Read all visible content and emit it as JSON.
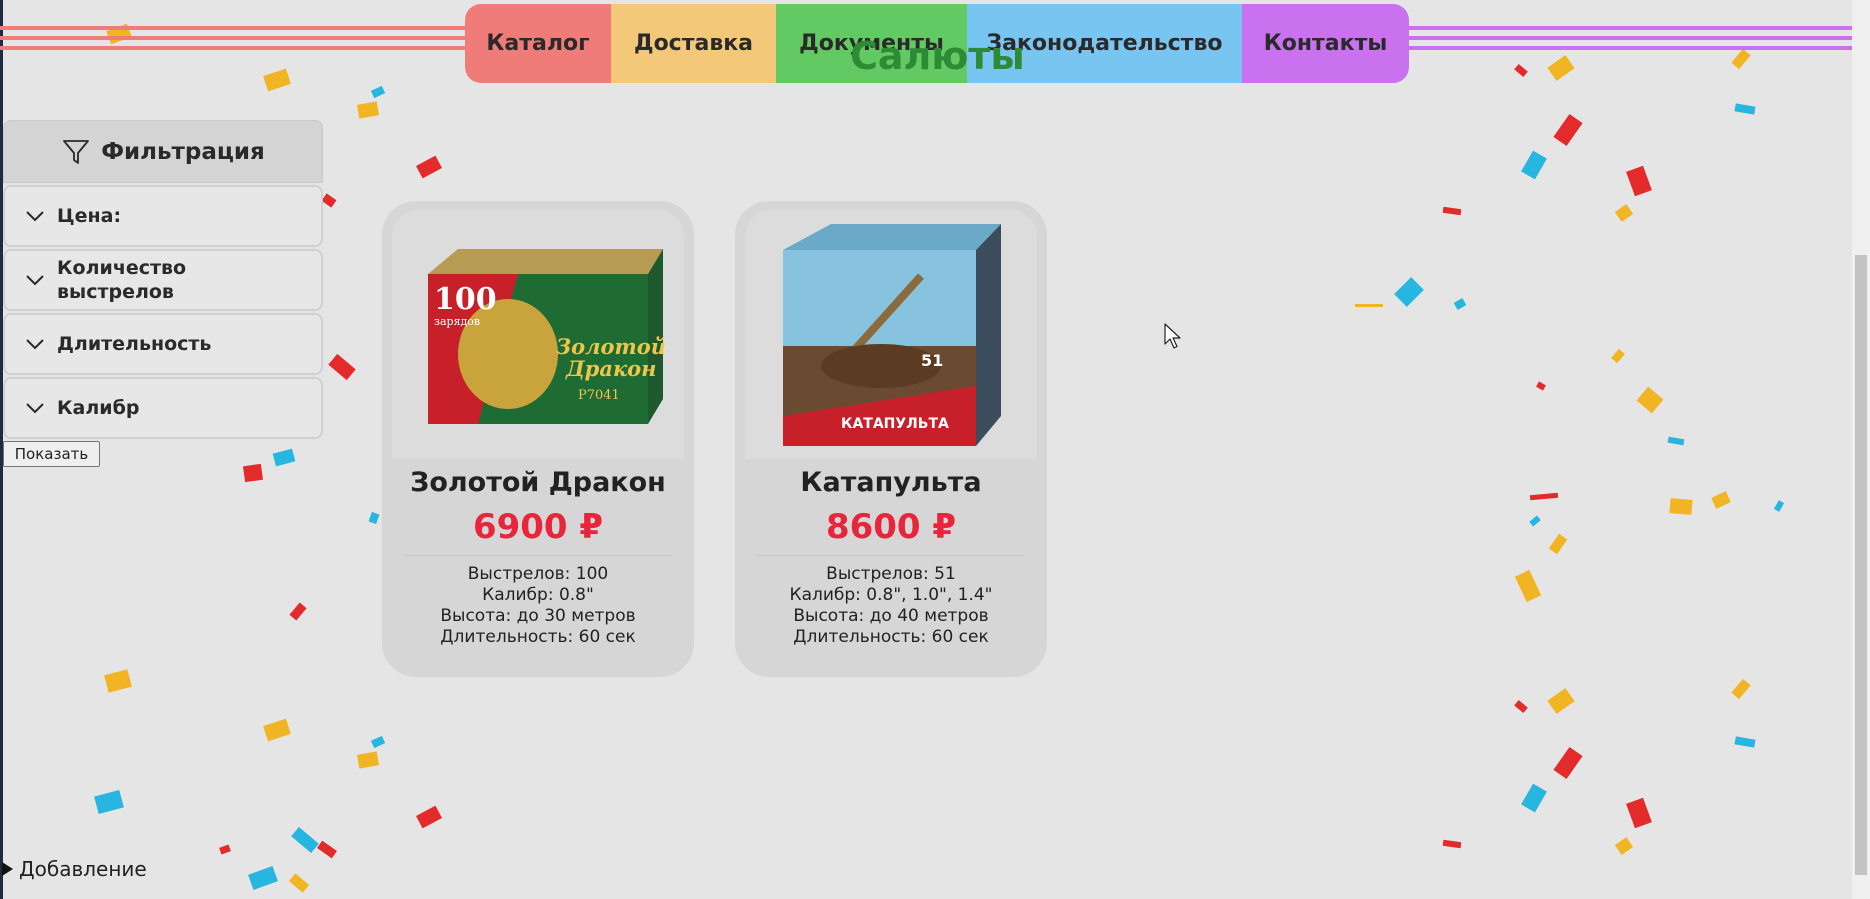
{
  "nav": {
    "items": [
      {
        "label": "Каталог",
        "color": "#ef7c78"
      },
      {
        "label": "Доставка",
        "color": "#f3c879"
      },
      {
        "label": "Документы",
        "color": "#63c963"
      },
      {
        "label": "Законодательство",
        "color": "#79c5f1"
      },
      {
        "label": "Контакты",
        "color": "#c971ee"
      }
    ]
  },
  "page_title": "Салюты",
  "filters": {
    "title": "Фильтрация",
    "icon": "funnel-icon",
    "groups": [
      {
        "label": "Цена:"
      },
      {
        "label": "Количество выстрелов"
      },
      {
        "label": "Длительность"
      },
      {
        "label": "Калибр"
      }
    ],
    "show_button": "Показать"
  },
  "products": [
    {
      "name": "Золотой Дракон",
      "price": "6900 ₽",
      "specs": [
        "Выстрелов: 100",
        "Калибр: 0.8\"",
        "Высота: до 30 метров",
        "Длительность: 60 сек"
      ],
      "image_text": {
        "left_top": "100",
        "left_bottom": "зарядов",
        "title_1": "Золотой",
        "title_2": "Дракон",
        "code": "Р7041"
      }
    },
    {
      "name": "Катапульта",
      "price": "8600 ₽",
      "specs": [
        "Выстрелов: 51",
        "Калибр: 0.8\", 1.0\", 1.4\"",
        "Высота: до 40 метров",
        "Длительность: 60 сек"
      ],
      "image_text": {
        "count": "51",
        "title": "КАТАПУЛЬТА"
      }
    }
  ],
  "details_summary": "Добавление",
  "colors": {
    "price": "#e8253a",
    "title": "#2e8a35",
    "background": "#e5e5e5"
  }
}
